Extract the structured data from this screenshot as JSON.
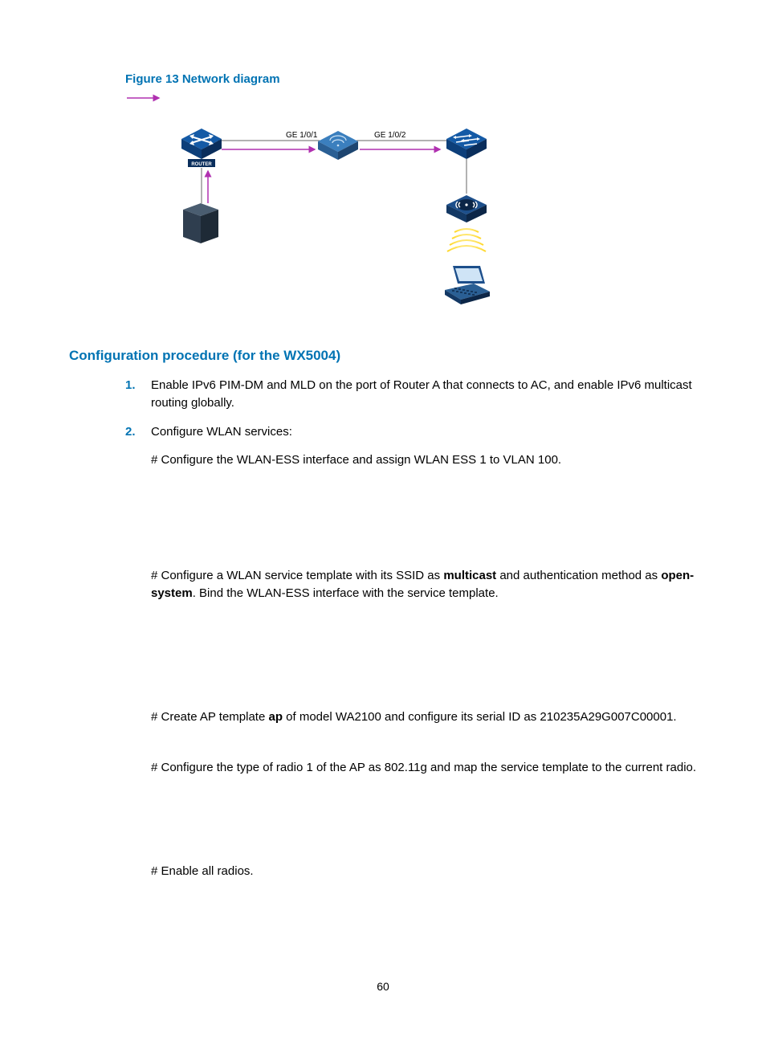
{
  "figure": {
    "caption": "Figure 13 Network diagram",
    "ge1": "GE 1/0/1",
    "ge2": "GE 1/0/2",
    "router_label": "ROUTER"
  },
  "section_heading": "Configuration procedure (for the WX5004)",
  "steps": {
    "s1": "Enable IPv6 PIM-DM and MLD on the port of Router A that connects to AC, and enable IPv6 multicast routing globally.",
    "s2": "Configure WLAN services:"
  },
  "para": {
    "p1": "# Configure the WLAN-ESS interface and assign WLAN ESS 1 to VLAN 100.",
    "p2a": "# Configure a WLAN service template with its SSID as ",
    "p2b": "multicast",
    "p2c": " and authentication method as ",
    "p2d": "open-system",
    "p2e": ". Bind the WLAN-ESS interface with the service template.",
    "p3a": "# Create AP template ",
    "p3b": "ap",
    "p3c": " of model WA2100 and configure its serial ID as 210235A29G007C00001.",
    "p4": "# Configure the type of radio 1 of the AP as 802.11g and map the service template to the current radio.",
    "p5": "# Enable all radios."
  },
  "page_number": "60"
}
